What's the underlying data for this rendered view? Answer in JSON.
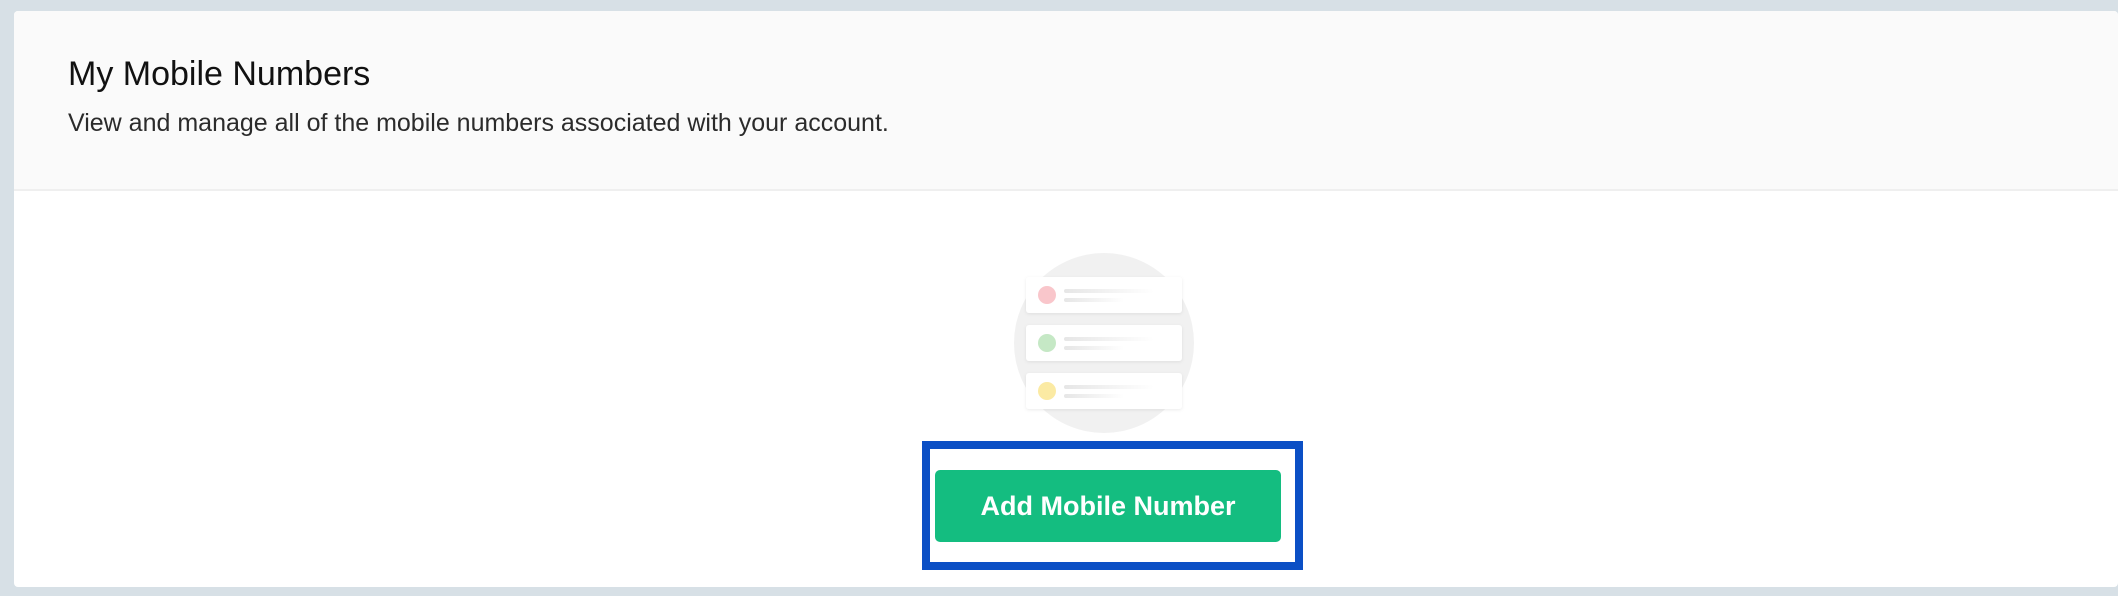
{
  "header": {
    "title": "My Mobile Numbers",
    "subtitle": "View and manage all of the mobile numbers associated with your account."
  },
  "empty_state": {
    "illustration_icon": "mobile-list-empty-icon",
    "dot_colors": [
      "#f9c6cb",
      "#c5e8c5",
      "#fbeaa3"
    ]
  },
  "actions": {
    "add_label": "Add Mobile Number",
    "button_color": "#14bd80",
    "highlight_color": "#0b4fc5"
  }
}
